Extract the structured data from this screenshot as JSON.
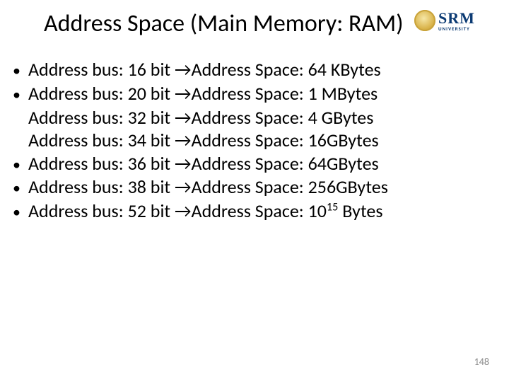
{
  "title": "Address Space (Main Memory: RAM)",
  "logo": {
    "brand": "SRM",
    "sub": "UNIVERSITY",
    "tagline": ""
  },
  "lines": [
    {
      "bulleted": true,
      "text": "Address bus: 16 bit →Address Space: 64 KBytes"
    },
    {
      "bulleted": true,
      "text": "Address bus: 20 bit →Address Space: 1 MBytes"
    },
    {
      "bulleted": false,
      "text": "Address bus: 32 bit →Address Space: 4 GBytes"
    },
    {
      "bulleted": false,
      "text": "Address bus: 34 bit →Address Space: 16GBytes"
    },
    {
      "bulleted": true,
      "text": "Address bus: 36 bit →Address Space: 64GBytes"
    },
    {
      "bulleted": true,
      "text": "Address bus: 38 bit →Address Space: 256GBytes"
    },
    {
      "bulleted": true,
      "text": "Address bus: 52 bit →Address Space: 10",
      "sup": "15",
      "tail": " Bytes"
    }
  ],
  "bullet_char": "•",
  "page_number": "148"
}
